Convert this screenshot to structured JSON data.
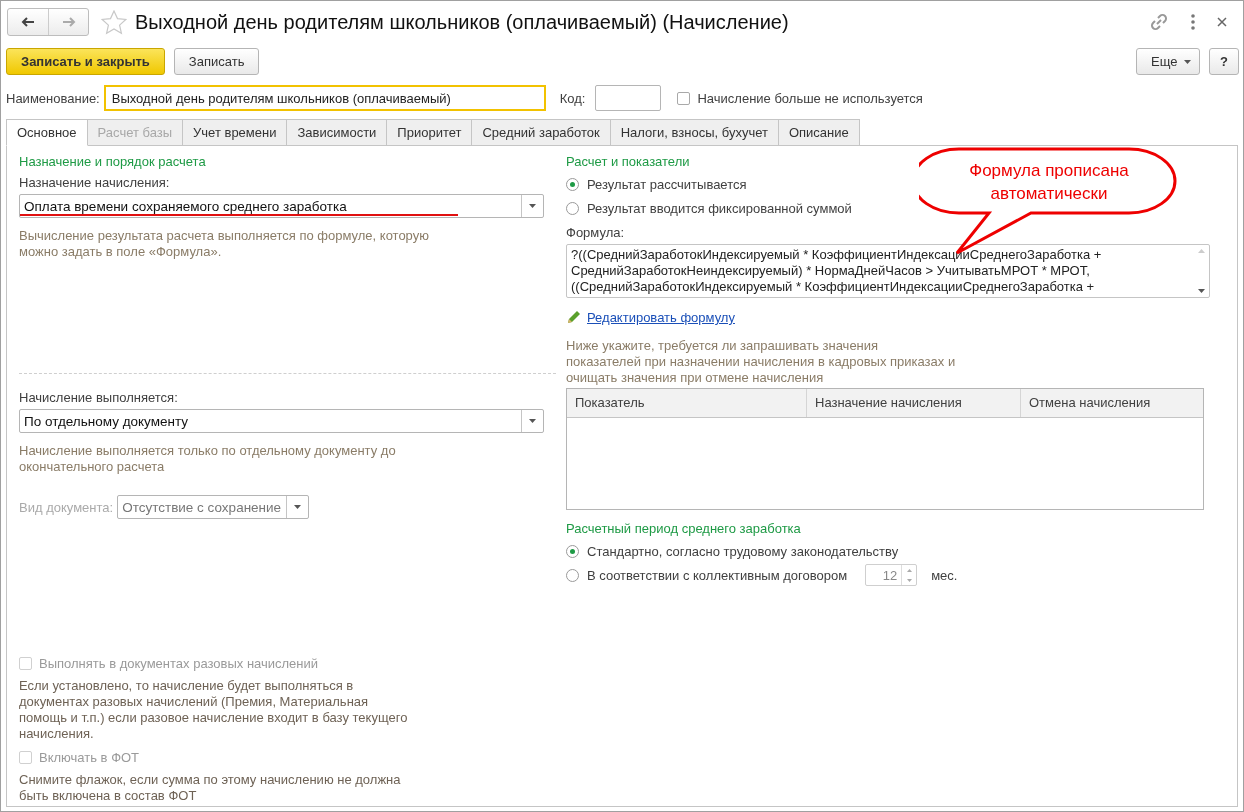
{
  "window": {
    "title": "Выходной день родителям школьников (оплачиваемый) (Начисление)"
  },
  "toolbar": {
    "buttons": [
      {
        "label": "Записать и закрыть",
        "kind": "primary"
      },
      {
        "label": "Записать",
        "kind": "default"
      }
    ],
    "more": "Еще",
    "help": "?"
  },
  "name_row": {
    "name_label": "Наименование:",
    "name_value": "Выходной день родителям школьников (оплачиваемый)",
    "code_label": "Код:",
    "unused": {
      "label": "Начисление больше не используется",
      "checked": false
    }
  },
  "tabs": [
    {
      "label": "Основное",
      "selected": true,
      "disabled": false
    },
    {
      "label": "Расчет базы",
      "selected": false,
      "disabled": true
    },
    {
      "label": "Учет времени",
      "selected": false,
      "disabled": false
    },
    {
      "label": "Зависимости",
      "selected": false,
      "disabled": false
    },
    {
      "label": "Приоритет",
      "selected": false,
      "disabled": false
    },
    {
      "label": "Средний заработок",
      "selected": false,
      "disabled": false
    },
    {
      "label": "Налоги, взносы, бухучет",
      "selected": false,
      "disabled": false
    },
    {
      "label": "Описание",
      "selected": false,
      "disabled": false
    }
  ],
  "left": {
    "heading": "Назначение и порядок расчета",
    "purpose_label": "Назначение начисления:",
    "purpose_value": "Оплата времени сохраняемого среднего заработка",
    "purpose_underlined": true,
    "purpose_hint": "Вычисление результата расчета выполняется по формуле, которую можно задать в поле «Формула».",
    "execution_label": "Начисление выполняется:",
    "execution_value": "По отдельному документу",
    "execution_hint": "Начисление выполняется только по отдельному документу до окончательного расчета",
    "doc_type": {
      "label": "Вид документа:",
      "value": "Отсутствие с сохранение",
      "disabled": true
    },
    "checks": [
      {
        "label": "Выполнять в документах разовых начислений",
        "checked": false,
        "disabled": true,
        "hint": "Если установлено, то начисление будет выполняться в документах разовых начислений (Премия, Материальная помощь и т.п.) если разовое начисление входит в базу текущего начисления."
      },
      {
        "label": "Включать в ФОТ",
        "checked": false,
        "disabled": true,
        "hint": "Снимите флажок, если сумма по этому начислению не должна быть включена в состав ФОТ"
      }
    ]
  },
  "right": {
    "heading": "Расчет и показатели",
    "result_options": [
      {
        "label": "Результат рассчитывается",
        "selected": true
      },
      {
        "label": "Результат вводится фиксированной суммой",
        "selected": false
      }
    ],
    "formula_label": "Формула:",
    "formula_lines": [
      "?((СреднийЗаработокИндексируемый * КоэффициентИндексацииСреднегоЗаработка +",
      "СреднийЗаработокНеиндексируемый) * НормаДнейЧасов > УчитыватьМРОТ * МРОТ,",
      "((СреднийЗаработокИндексируемый * КоэффициентИндексацииСреднегоЗаработка +"
    ],
    "edit_link": "Редактировать формулу",
    "indicators_hint": [
      "Ниже укажите, требуется ли запрашивать значения",
      "показателей при назначении начисления в кадровых приказах и",
      "очищать значения при отмене начисления"
    ],
    "table": {
      "columns": [
        "Показатель",
        "Назначение начисления",
        "Отмена начисления"
      ]
    },
    "period_heading": "Расчетный период среднего заработка",
    "period_options": [
      {
        "label": "Стандартно, согласно трудовому законодательству",
        "selected": true
      },
      {
        "label": "В соответствии с коллективным договором",
        "selected": false,
        "months": "12",
        "unit": "мес."
      }
    ]
  },
  "callout": {
    "text": "Формула прописана автоматически"
  }
}
